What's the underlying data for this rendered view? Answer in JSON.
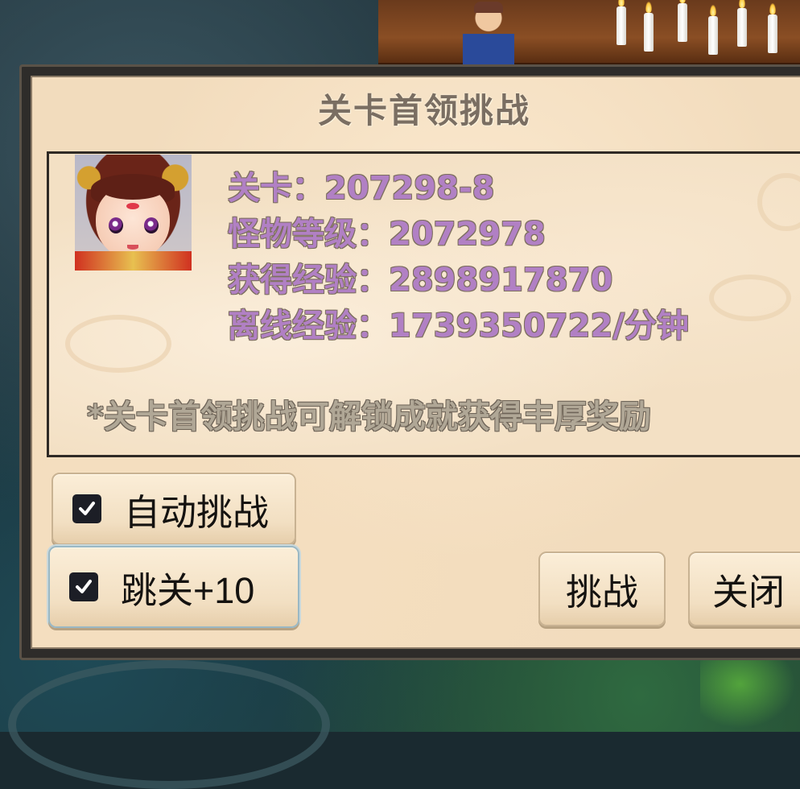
{
  "dialog": {
    "title": "关卡首领挑战",
    "info": {
      "stage": "关卡：207298-8",
      "monster_level": "怪物等级：2072978",
      "exp_gain": "获得经验：2898917870",
      "offline_exp": "离线经验：1739350722/分钟"
    },
    "tip": "*关卡首领挑战可解锁成就获得丰厚奖励",
    "toggles": {
      "auto_challenge": {
        "label": "自动挑战",
        "checked": true
      },
      "skip_stages": {
        "label": "跳关+10",
        "checked": true
      }
    },
    "buttons": {
      "challenge": "挑战",
      "close": "关闭"
    }
  },
  "colors": {
    "info_text": "#b180c4",
    "title_text": "#7a6e62",
    "panel_bg": "#f2dcbd",
    "frame": "#2e2c2a"
  },
  "icons": {
    "boss_avatar": "boss-portrait",
    "checkbox": "checkmark-icon"
  }
}
